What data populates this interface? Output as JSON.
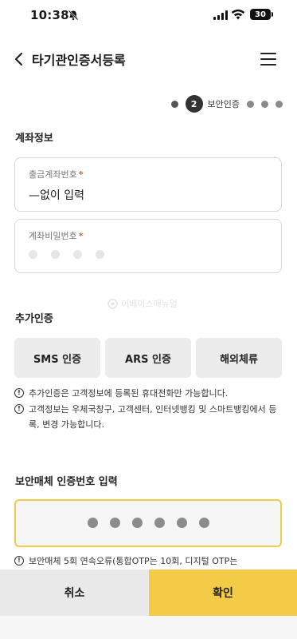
{
  "status_bar": {
    "time": "10:38",
    "battery": "30"
  },
  "header": {
    "title": "타기관인증서등록"
  },
  "stepper": {
    "current_step": "2",
    "current_label": "보안인증"
  },
  "account_section": {
    "title": "계좌정보",
    "account_field": {
      "label": "출금계좌번호",
      "required_mark": "*",
      "value": "—없이 입력"
    },
    "password_field": {
      "label": "계좌비밀번호",
      "required_mark": "*"
    }
  },
  "watermark": "이베이스매뉴얼",
  "additional_auth": {
    "title": "추가인증",
    "buttons": [
      "SMS 인증",
      "ARS 인증",
      "해외체류"
    ],
    "notes": [
      "추가인증은 고객정보에 등록된 휴대전화만 가능합니다.",
      "고객정보는 우체국창구, 고객센터, 인터넷뱅킹 및 스마트뱅킹에서 등록, 변경 가능합니다."
    ]
  },
  "security_medium": {
    "title": "보안매체 인증번호 입력",
    "note": "보안매체 5회 연속오류(통합OTP는 10회, 디지털 OTP는"
  },
  "footer": {
    "cancel_label": "취소",
    "confirm_label": "확인"
  },
  "colors": {
    "accent": "#f4cb47",
    "required": "#e46a1f",
    "otp_border": "#efcb49"
  }
}
